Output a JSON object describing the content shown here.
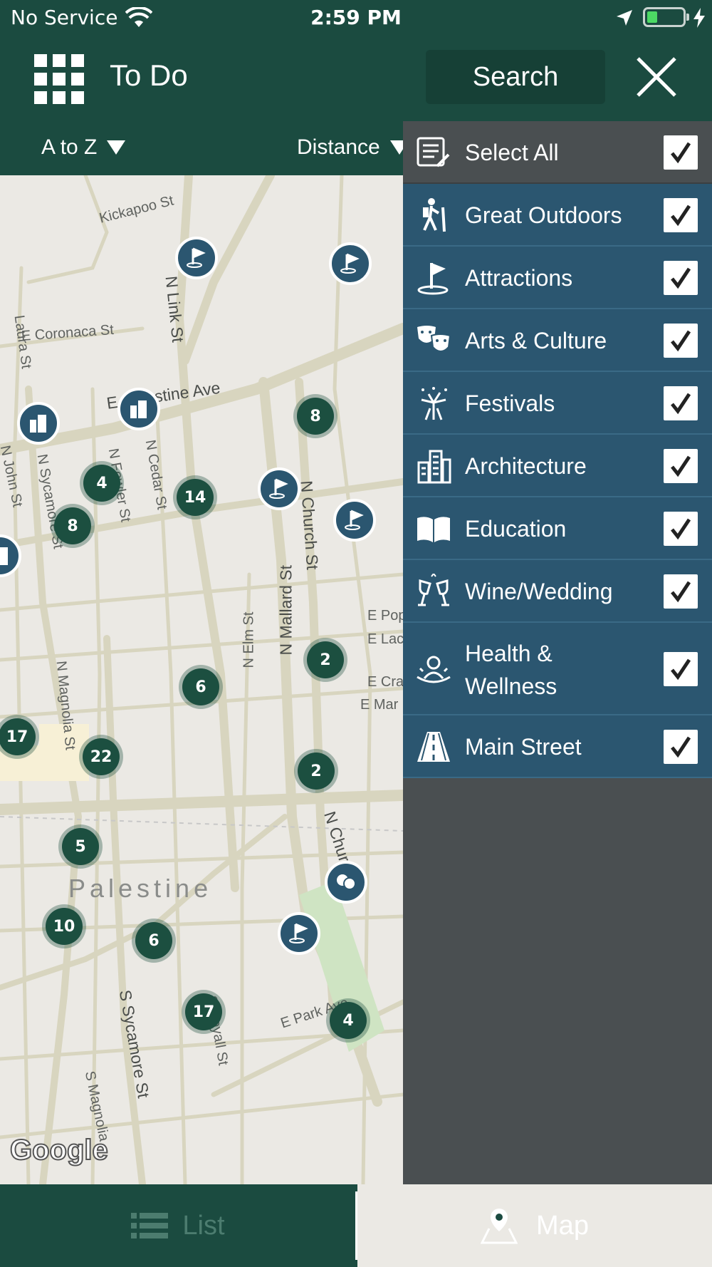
{
  "status_bar": {
    "carrier": "No Service",
    "time": "2:59 PM",
    "battery_color": "#4cd964"
  },
  "header": {
    "title": "To Do",
    "search_label": "Search",
    "menu_icon": "grid-menu-icon",
    "close_icon": "close-icon"
  },
  "sort_bar": {
    "alpha_label": "A to Z",
    "distance_label": "Distance"
  },
  "map": {
    "city_label": "Palestine",
    "attribution": "Google",
    "streets": [
      "Kickapoo St",
      "Laura St",
      "E Coronaca St",
      "N Link St",
      "E Palestine Ave",
      "N John St",
      "N Sycamore St",
      "N Fowler St",
      "N Cedar St",
      "N Church St",
      "N Mallard St",
      "N Elm St",
      "N Magnolia St",
      "E Pop",
      "E Lac",
      "E Cra",
      "E Mar",
      "N Church",
      "S Sycamore St",
      "S Royall St",
      "E Park Ave",
      "S Magnolia"
    ],
    "clusters": [
      "8",
      "4",
      "14",
      "8",
      "2",
      "6",
      "17",
      "22",
      "2",
      "5",
      "10",
      "6",
      "17",
      "4"
    ]
  },
  "filter_panel": {
    "items": [
      {
        "label": "Select All",
        "icon": "checklist-icon",
        "checked": true
      },
      {
        "label": "Great Outdoors",
        "icon": "hiker-icon",
        "checked": true
      },
      {
        "label": "Attractions",
        "icon": "flag-icon",
        "checked": true
      },
      {
        "label": "Arts & Culture",
        "icon": "theater-masks-icon",
        "checked": true
      },
      {
        "label": "Festivals",
        "icon": "fireworks-icon",
        "checked": true
      },
      {
        "label": "Architecture",
        "icon": "buildings-icon",
        "checked": true
      },
      {
        "label": "Education",
        "icon": "book-icon",
        "checked": true
      },
      {
        "label": "Wine/Wedding",
        "icon": "wine-glasses-icon",
        "checked": true
      },
      {
        "label": "Health & Wellness",
        "icon": "spa-person-icon",
        "checked": true
      },
      {
        "label": "Main Street",
        "icon": "road-icon",
        "checked": true
      }
    ]
  },
  "tabs": {
    "list_label": "List",
    "map_label": "Map",
    "active": "Map"
  },
  "colors": {
    "header_bg": "#1b4b40",
    "panel_row": "#2b5670",
    "panel_bg": "#4a4f51",
    "cluster": "#1c4f40"
  }
}
